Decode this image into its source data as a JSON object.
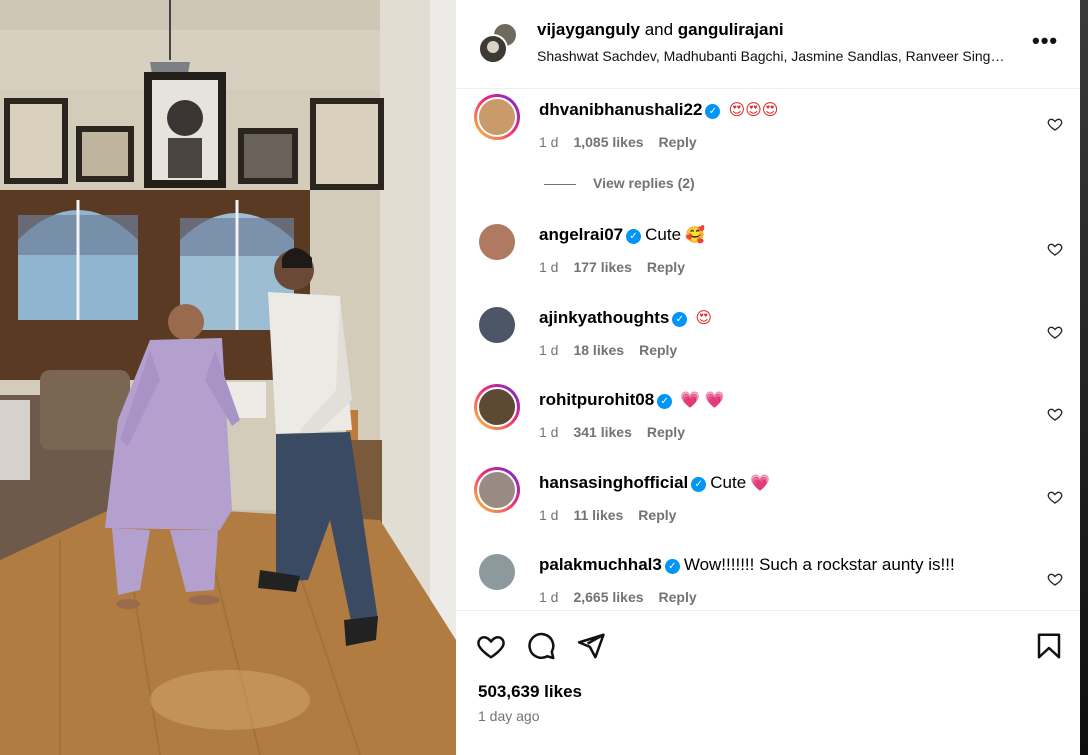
{
  "header": {
    "user1": "vijayganguly",
    "joiner": " and ",
    "user2": "gangulirajani",
    "collaborators": "Shashwat Sachdev, Madhubanti Bagchi, Jasmine Sandlas, Ranveer Sing…",
    "more": "•••"
  },
  "comments": [
    {
      "user": "dhvanibhanushali22",
      "verified": true,
      "text": "",
      "emoji": "😍😍😍",
      "age": "1 d",
      "likes": "1,085 likes",
      "reply": "Reply",
      "ring": true,
      "avatar_color": "#c99a6a"
    },
    {
      "user": "angelrai07",
      "verified": true,
      "text": "Cute",
      "emoji": "🥰",
      "age": "1 d",
      "likes": "177 likes",
      "reply": "Reply",
      "ring": false,
      "avatar_color": "#b07a62"
    },
    {
      "user": "ajinkyathoughts",
      "verified": true,
      "text": "",
      "emoji": "😍",
      "age": "1 d",
      "likes": "18 likes",
      "reply": "Reply",
      "ring": false,
      "avatar_color": "#4d5666"
    },
    {
      "user": "rohitpurohit08",
      "verified": true,
      "text": "",
      "emoji": "💗 💗",
      "age": "1 d",
      "likes": "341 likes",
      "reply": "Reply",
      "ring": true,
      "avatar_color": "#5c4a35"
    },
    {
      "user": "hansasinghofficial",
      "verified": true,
      "text": "Cute",
      "emoji": "💗",
      "age": "1 d",
      "likes": "11 likes",
      "reply": "Reply",
      "ring": true,
      "avatar_color": "#9a8a84"
    },
    {
      "user": "palakmuchhal3",
      "verified": true,
      "text": "Wow!!!!!!! Such a rockstar aunty is!!!",
      "emoji": "",
      "age": "1 d",
      "likes": "2,665 likes",
      "reply": "Reply",
      "ring": false,
      "avatar_color": "#8c9a9e"
    }
  ],
  "view_replies": "View replies (2)",
  "post": {
    "likes": "503,639 likes",
    "time": "1 day ago"
  },
  "colors": {
    "verified": "#0095f6",
    "secondary_text": "#737373",
    "ring_start": "#f9ce34",
    "ring_mid": "#ee2a7b",
    "ring_end": "#6228d7"
  },
  "icons": {
    "like": "heart-icon",
    "comment": "comment-icon",
    "share": "send-icon",
    "save": "bookmark-icon",
    "more": "more-options-icon"
  }
}
